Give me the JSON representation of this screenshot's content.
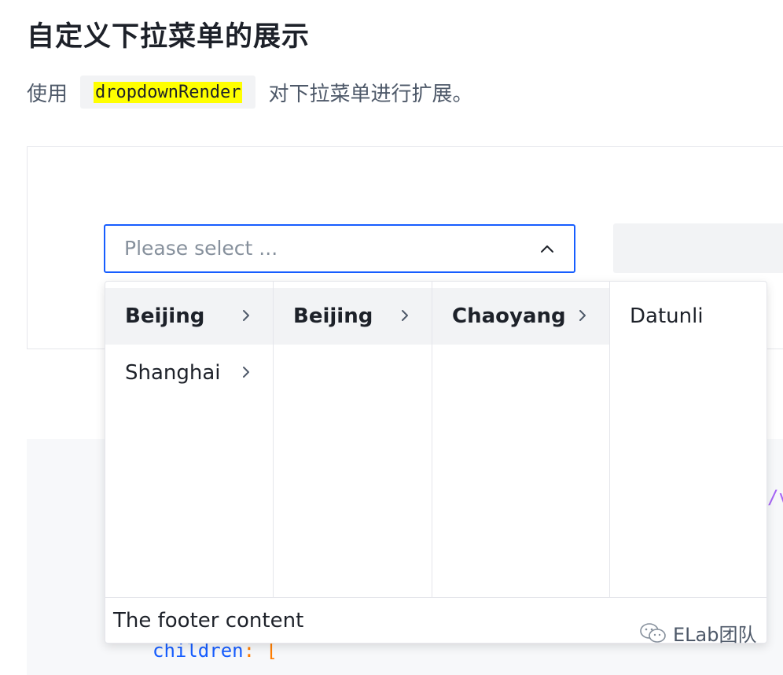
{
  "page": {
    "title": "自定义下拉菜单的展示",
    "desc_prefix": "使用",
    "desc_code": "dropdownRender",
    "desc_suffix": "对下拉菜单进行扩展。"
  },
  "select": {
    "placeholder": "Please select ..."
  },
  "dropdown": {
    "columns": [
      {
        "options": [
          {
            "label": "Beijing",
            "has_children": true,
            "active": true
          },
          {
            "label": "Shanghai",
            "has_children": true,
            "active": false
          }
        ]
      },
      {
        "options": [
          {
            "label": "Beijing",
            "has_children": true,
            "active": true
          }
        ]
      },
      {
        "options": [
          {
            "label": "Chaoyang",
            "has_children": true,
            "active": true
          }
        ]
      },
      {
        "options": [
          {
            "label": "Datunli",
            "has_children": false,
            "active": false
          }
        ]
      }
    ],
    "footer": "The footer content"
  },
  "code": {
    "fragment": "/v",
    "line_key": "children",
    "line_punct": ": ["
  },
  "watermark": {
    "text": "ELab团队"
  },
  "colors": {
    "accent": "#165dff",
    "highlight": "#ffff00",
    "active_bg": "#f2f3f5"
  }
}
